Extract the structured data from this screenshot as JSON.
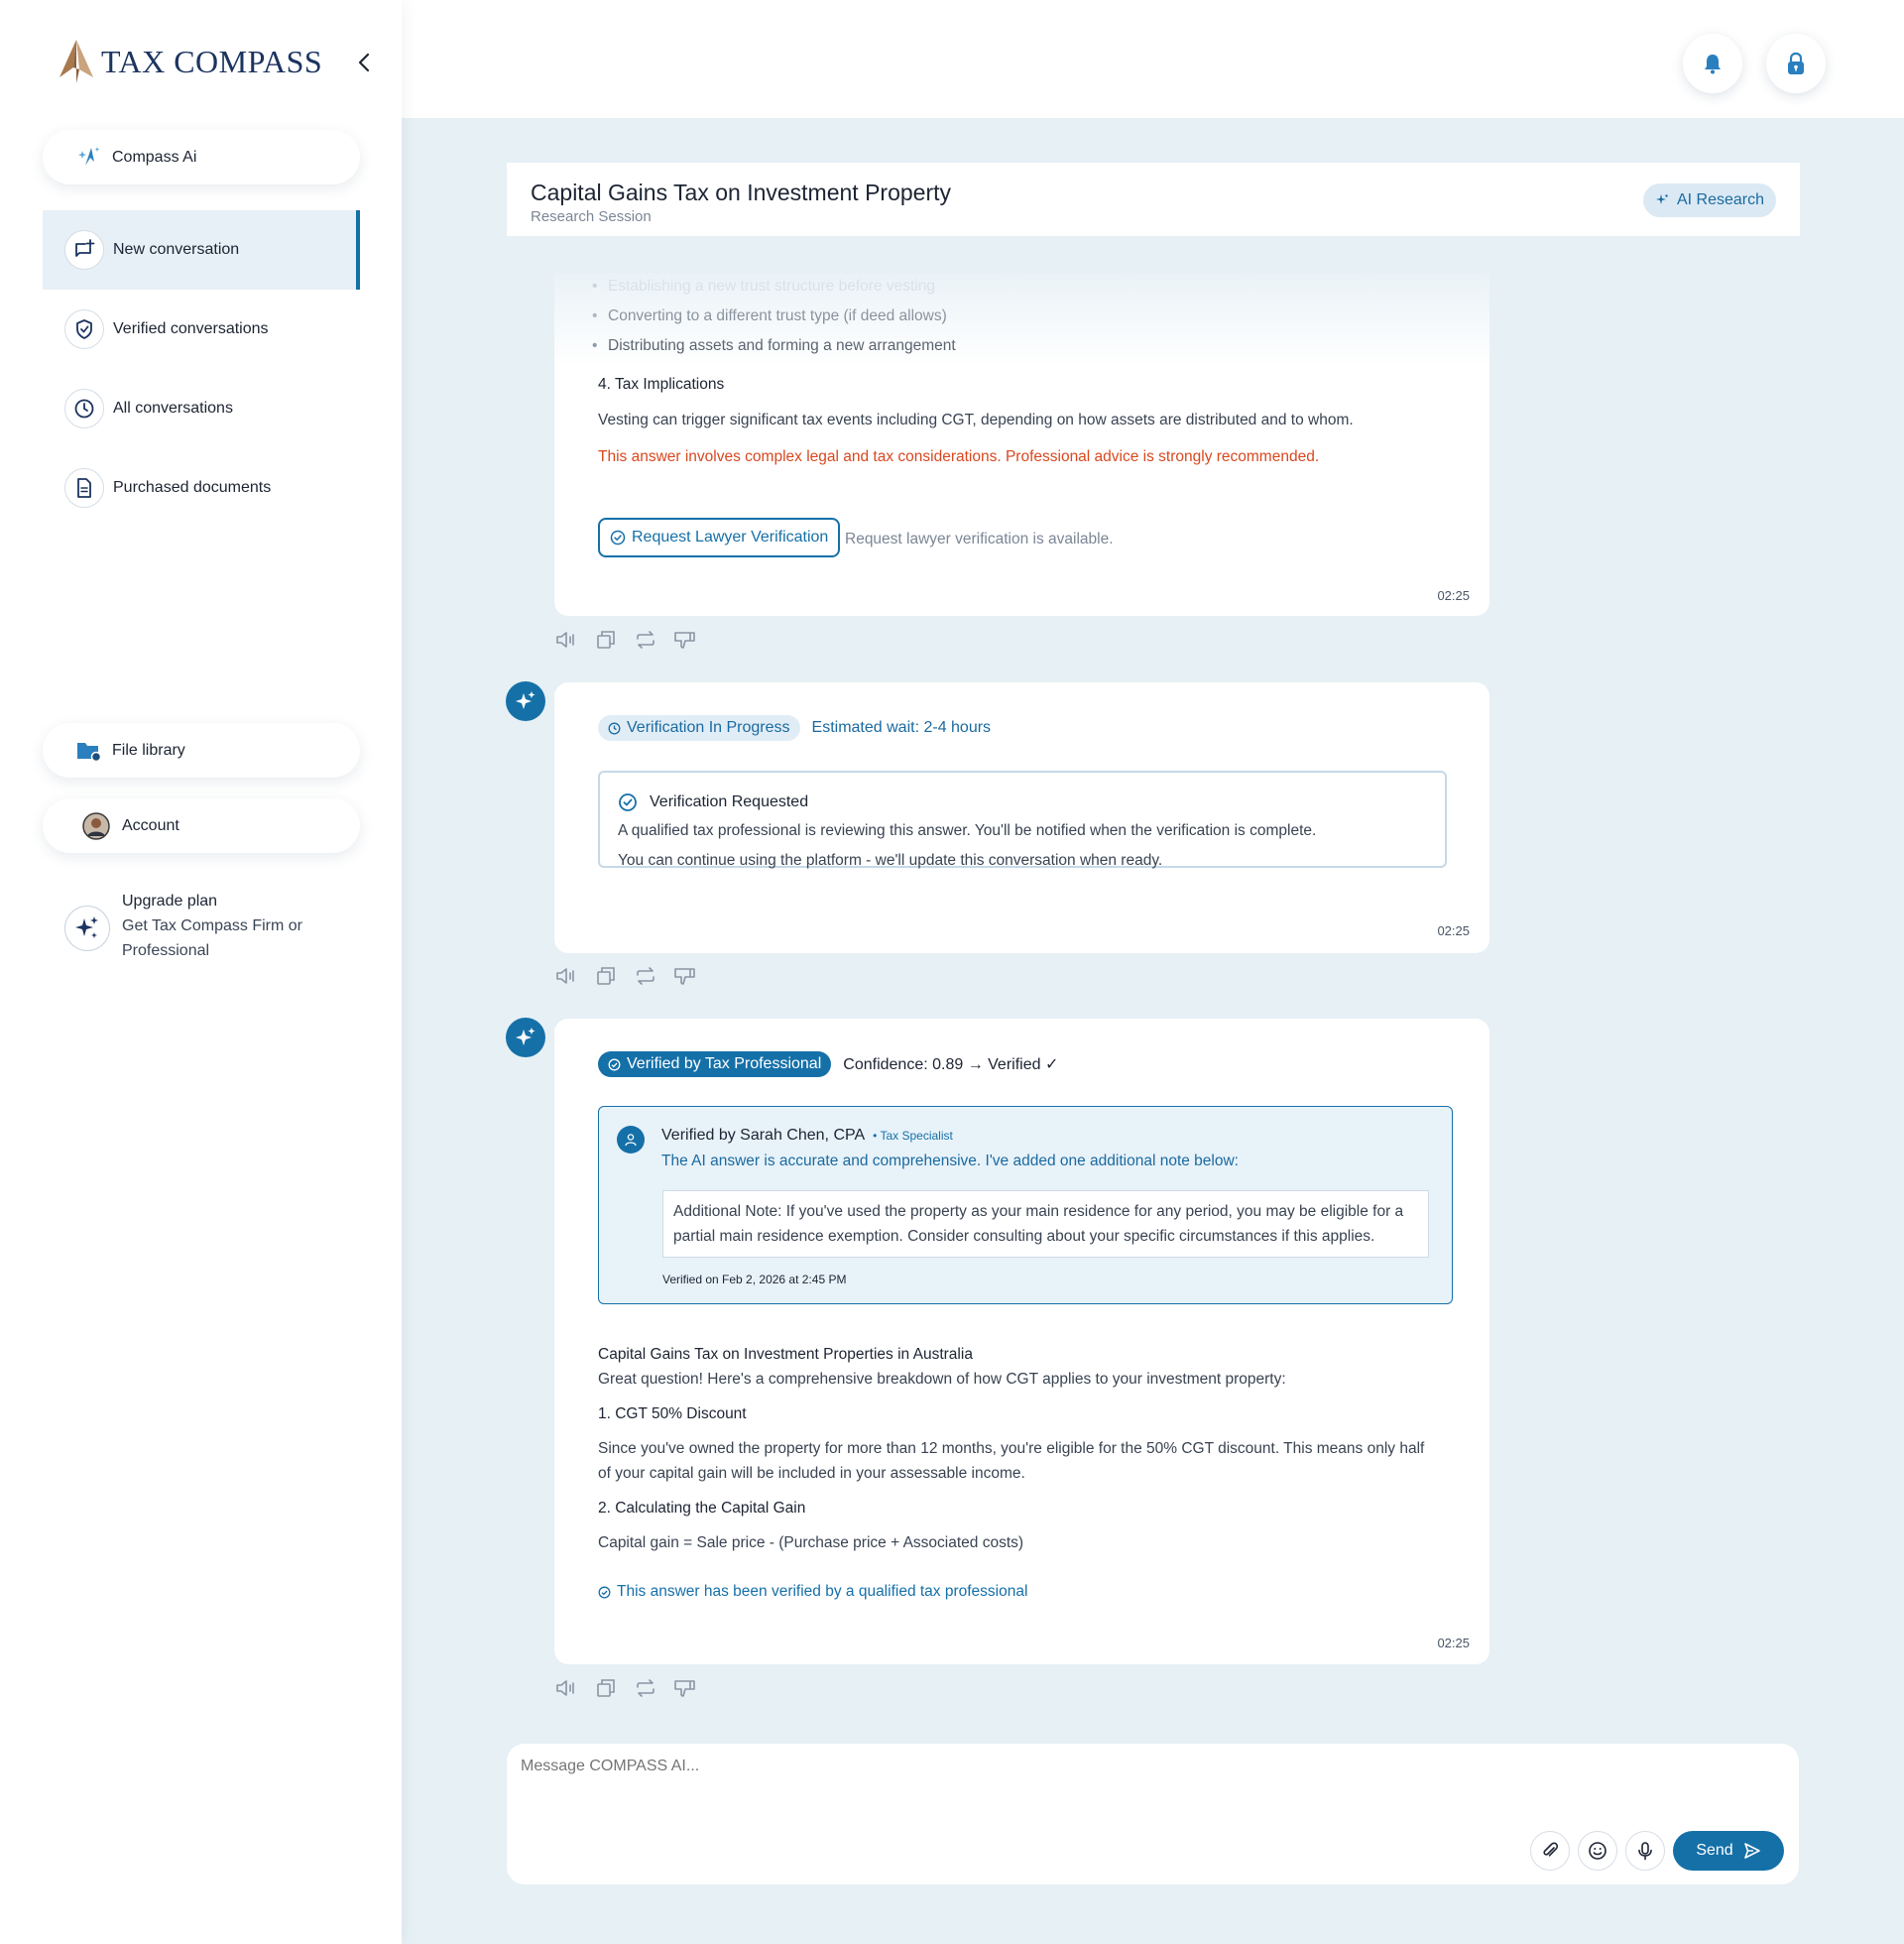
{
  "brand": {
    "name": "TAX COMPASS"
  },
  "sidebar": {
    "compass_ai": "Compass Ai",
    "nav": [
      {
        "label": "New conversation",
        "active": true
      },
      {
        "label": "Verified conversations"
      },
      {
        "label": "All conversations"
      },
      {
        "label": "Purchased documents"
      }
    ],
    "file_library": "File library",
    "account": "Account",
    "upgrade": {
      "title": "Upgrade plan",
      "subtitle": "Get Tax Compass Firm or Professional"
    }
  },
  "session": {
    "title": "Capital Gains Tax on Investment Property",
    "subtitle": "Research Session",
    "tag": "AI Research"
  },
  "message1": {
    "bullets": [
      "Establishing a new trust structure before vesting",
      "Converting to a different trust type (if deed allows)",
      "Distributing assets and forming a new arrangement"
    ],
    "heading": "4. Tax Implications",
    "body": "Vesting can trigger significant tax events including CGT, depending on how assets are distributed and to whom.",
    "warning": "This answer involves complex legal and tax considerations. Professional advice is strongly recommended.",
    "button": "Request Lawyer Verification",
    "button_note": "Request lawyer verification is available.",
    "time": "02:25"
  },
  "message2": {
    "badge": "Verification In Progress",
    "wait": "Estimated wait: 2-4 hours",
    "box_title": "Verification Requested",
    "box_line1": "A qualified tax professional is reviewing this answer. You'll be notified when the verification is complete.",
    "box_line2": "You can continue using the platform - we'll update this conversation when ready.",
    "time": "02:25"
  },
  "message3": {
    "badge": "Verified by Tax Professional",
    "confidence": "Confidence: 0.89 → Verified ✓",
    "verifier": "Verified by Sarah Chen, CPA",
    "role": "• Tax Specialist",
    "verifier_note": "The AI answer is accurate and comprehensive. I've added one additional note below:",
    "additional_note": "Additional Note: If you've used the property as your main residence for any period, you may be eligible for a partial main residence exemption. Consider consulting about your specific circumstances if this applies.",
    "verified_on": "Verified on Feb 2, 2026 at 2:45 PM",
    "title": "Capital Gains Tax on Investment Properties in Australia",
    "intro": "Great question! Here's a comprehensive breakdown of how CGT applies to your investment property:",
    "h1": "1. CGT 50% Discount",
    "p1": "Since you've owned the property for more than 12 months, you're eligible for the 50% CGT discount. This means only half of your capital gain will be included in your assessable income.",
    "h2": "2. Calculating the Capital Gain",
    "p2": "Capital gain = Sale price - (Purchase price + Associated costs)",
    "footer": "This answer has been verified by a qualified tax professional",
    "time": "02:25"
  },
  "composer": {
    "placeholder": "Message COMPASS AI...",
    "send": "Send"
  },
  "icons": [
    "bell-icon",
    "lock-icon",
    "chevron-left-icon",
    "sparkle-icon",
    "chat-plus-icon",
    "shield-check-icon",
    "clock-icon",
    "document-icon",
    "folder-icon",
    "speaker-icon",
    "copy-icon",
    "repeat-icon",
    "thumbs-down-icon",
    "paperclip-icon",
    "smile-icon",
    "mic-icon",
    "send-icon"
  ],
  "colors": {
    "primary": "#1570a8",
    "warning": "#d9481f",
    "background": "#e6f0f5",
    "brand_gold": "#b88a5e",
    "brand_navy": "#1c3460"
  }
}
